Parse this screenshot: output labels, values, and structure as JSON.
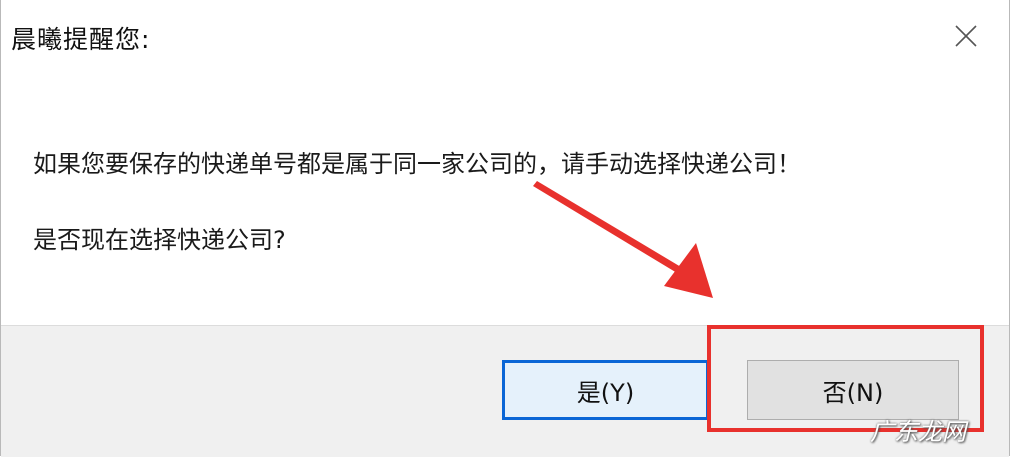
{
  "dialog": {
    "title": "晨曦提醒您:",
    "message_line1": "如果您要保存的快递单号都是属于同一家公司的，请手动选择快递公司！",
    "message_line2": "是否现在选择快递公司?",
    "buttons": {
      "yes_label": "是(Y)",
      "no_label": "否(N)"
    }
  },
  "annotation": {
    "highlight_color": "#e8312d",
    "arrow_color": "#e8312d"
  },
  "watermark": "广东龙网"
}
